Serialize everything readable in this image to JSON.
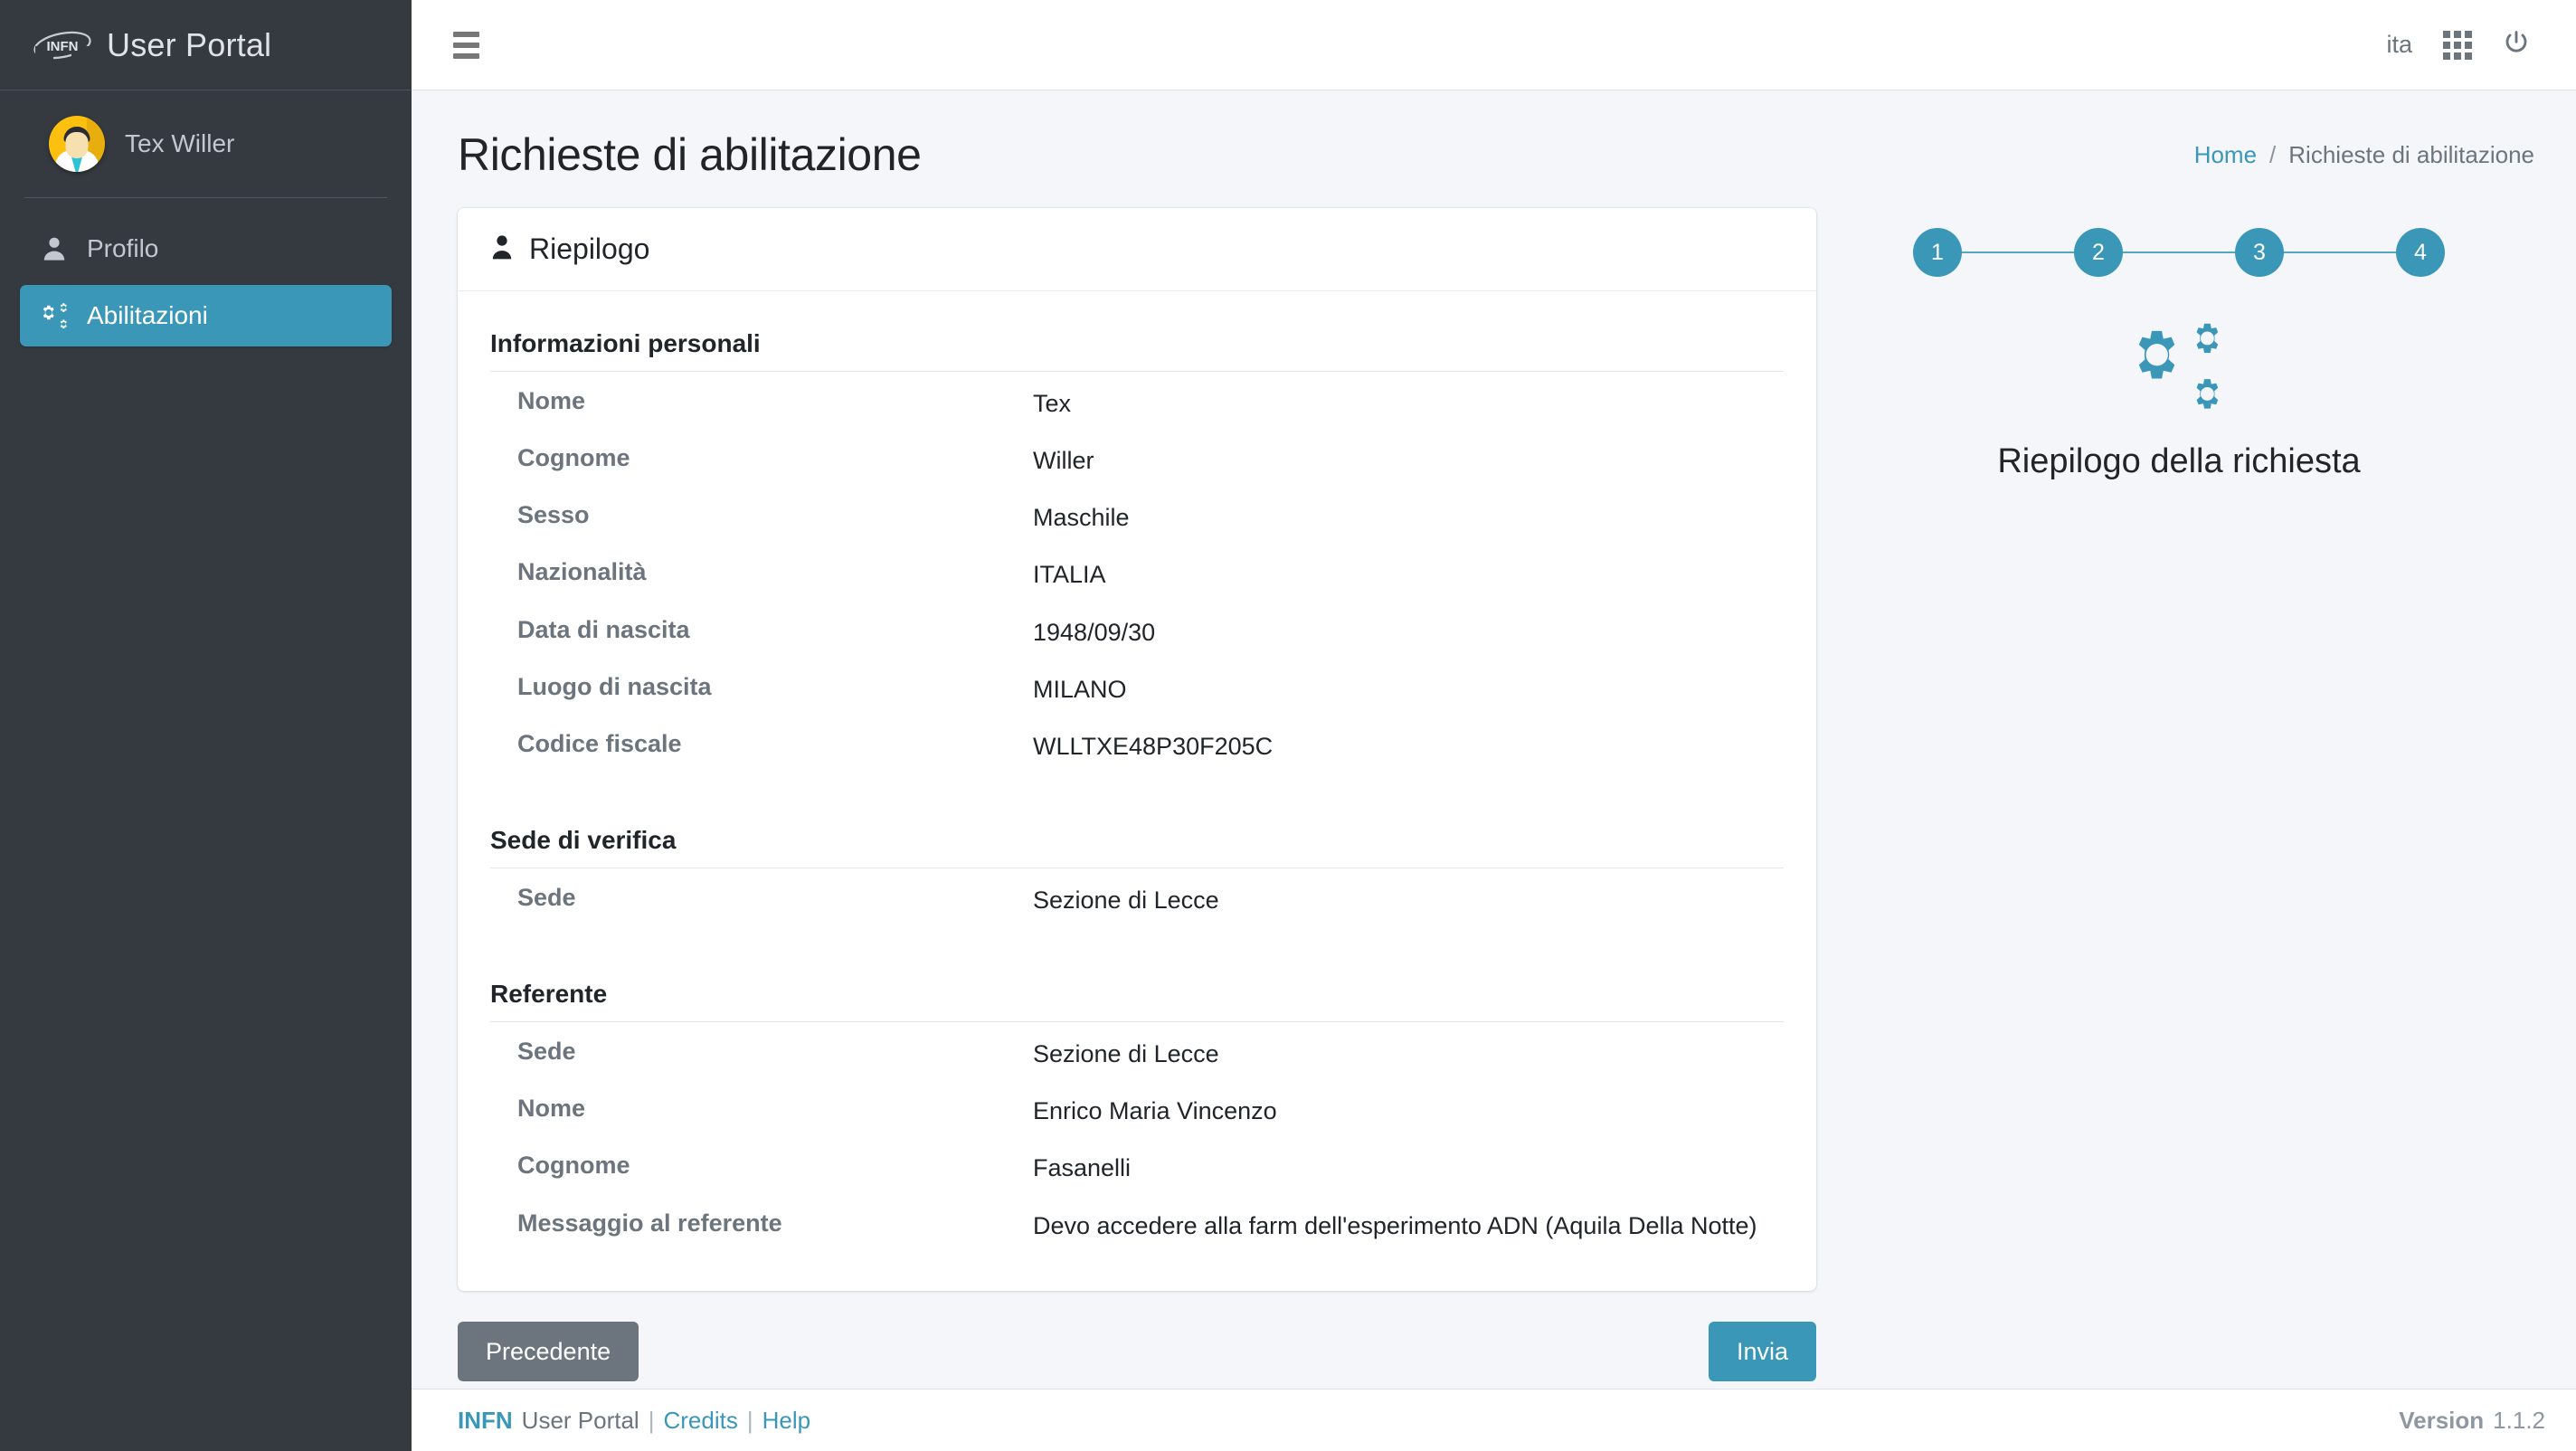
{
  "sidebar": {
    "brand": {
      "logo_text": "INFN",
      "title": "User Portal"
    },
    "user": {
      "name": "Tex Willer",
      "avatar_icon": "user-avatar"
    },
    "items": [
      {
        "label": "Profilo",
        "icon": "user-icon",
        "active": false
      },
      {
        "label": "Abilitazioni",
        "icon": "gears-icon",
        "active": true
      }
    ]
  },
  "topbar": {
    "menu_icon": "hamburger-icon",
    "language": "ita",
    "apps_icon": "grid-apps-icon",
    "logout_icon": "power-icon"
  },
  "page": {
    "title": "Richieste di abilitazione",
    "breadcrumb": {
      "home": "Home",
      "separator": "/",
      "current": "Richieste di abilitazione"
    }
  },
  "card": {
    "header_icon": "person-icon",
    "header_title": "Riepilogo",
    "sections": [
      {
        "title": "Informazioni personali",
        "rows": [
          {
            "label": "Nome",
            "value": "Tex"
          },
          {
            "label": "Cognome",
            "value": "Willer"
          },
          {
            "label": "Sesso",
            "value": "Maschile"
          },
          {
            "label": "Nazionalità",
            "value": "ITALIA"
          },
          {
            "label": "Data di nascita",
            "value": "1948/09/30"
          },
          {
            "label": "Luogo di nascita",
            "value": "MILANO"
          },
          {
            "label": "Codice fiscale",
            "value": "WLLTXE48P30F205C"
          }
        ]
      },
      {
        "title": "Sede di verifica",
        "rows": [
          {
            "label": "Sede",
            "value": "Sezione di Lecce"
          }
        ]
      },
      {
        "title": "Referente",
        "rows": [
          {
            "label": "Sede",
            "value": "Sezione di Lecce"
          },
          {
            "label": "Nome",
            "value": "Enrico Maria Vincenzo"
          },
          {
            "label": "Cognome",
            "value": "Fasanelli"
          },
          {
            "label": "Messaggio al referente",
            "value": "Devo accedere alla farm dell'esperimento ADN (Aquila Della Notte)"
          }
        ]
      }
    ]
  },
  "actions": {
    "previous_label": "Precedente",
    "submit_label": "Invia"
  },
  "wizard": {
    "steps": [
      "1",
      "2",
      "3",
      "4"
    ],
    "illustration_icon": "gears-icon",
    "caption": "Riepilogo della richiesta",
    "accent_color": "#3a97b8"
  },
  "footer": {
    "brand": "INFN",
    "product": "User Portal",
    "sep1": "|",
    "credits": "Credits",
    "sep2": "|",
    "help": "Help",
    "version_label": "Version",
    "version_number": "1.1.2"
  }
}
